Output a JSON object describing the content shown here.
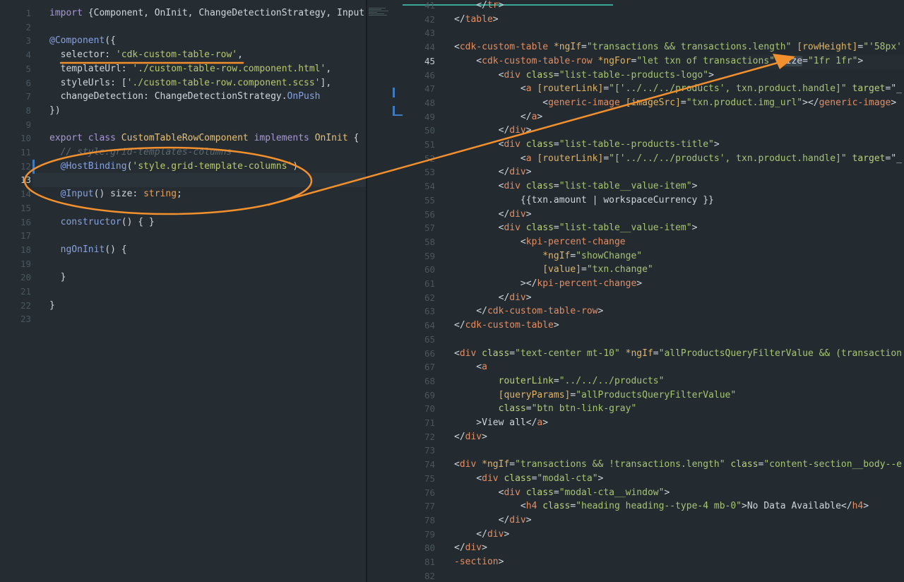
{
  "left_editor": {
    "lines": [
      {
        "n": "1",
        "tokens": [
          [
            "k",
            "import "
          ],
          [
            "p",
            "{Component, OnInit, ChangeDetectionStrategy, Input"
          ]
        ]
      },
      {
        "n": "2",
        "tokens": []
      },
      {
        "n": "3",
        "tokens": [
          [
            "d",
            "@Component"
          ],
          [
            "p",
            "({"
          ]
        ]
      },
      {
        "n": "4",
        "tokens": [
          [
            "p",
            "  selector: "
          ],
          [
            "s",
            "'cdk-custom-table-row'"
          ],
          [
            "p",
            ","
          ]
        ]
      },
      {
        "n": "5",
        "tokens": [
          [
            "p",
            "  templateUrl: "
          ],
          [
            "s",
            "'./custom-table-row.component.html'"
          ],
          [
            "p",
            ","
          ]
        ]
      },
      {
        "n": "6",
        "tokens": [
          [
            "p",
            "  styleUrls: ["
          ],
          [
            "s",
            "'./custom-table-row.component.scss'"
          ],
          [
            "p",
            "],"
          ]
        ]
      },
      {
        "n": "7",
        "tokens": [
          [
            "p",
            "  changeDetection: ChangeDetectionStrategy."
          ],
          [
            "d",
            "OnPush"
          ]
        ]
      },
      {
        "n": "8",
        "tokens": [
          [
            "p",
            "})"
          ]
        ]
      },
      {
        "n": "9",
        "tokens": []
      },
      {
        "n": "10",
        "tokens": [
          [
            "k",
            "export class "
          ],
          [
            "cls",
            "CustomTableRowComponent "
          ],
          [
            "k",
            "implements "
          ],
          [
            "cls",
            "OnInit "
          ],
          [
            "p",
            "{"
          ]
        ]
      },
      {
        "n": "11",
        "tokens": [
          [
            "c",
            "  // style.grid-templates-columns"
          ]
        ]
      },
      {
        "n": "12",
        "tokens": [
          [
            "d",
            "  @HostBinding"
          ],
          [
            "p",
            "("
          ],
          [
            "s",
            "'style.grid-template-columns'"
          ],
          [
            "p",
            ")"
          ]
        ]
      },
      {
        "n": "13",
        "tokens": []
      },
      {
        "n": "14",
        "tokens": [
          [
            "d",
            "  @Input"
          ],
          [
            "p",
            "() size: "
          ],
          [
            "t",
            "string"
          ],
          [
            "p",
            ";"
          ]
        ]
      },
      {
        "n": "15",
        "tokens": []
      },
      {
        "n": "16",
        "tokens": [
          [
            "d",
            "  constructor"
          ],
          [
            "p",
            "() { }"
          ]
        ]
      },
      {
        "n": "17",
        "tokens": []
      },
      {
        "n": "18",
        "tokens": [
          [
            "d",
            "  ngOnInit"
          ],
          [
            "p",
            "() {"
          ]
        ]
      },
      {
        "n": "19",
        "tokens": []
      },
      {
        "n": "20",
        "tokens": [
          [
            "p",
            "  }"
          ]
        ]
      },
      {
        "n": "21",
        "tokens": []
      },
      {
        "n": "22",
        "tokens": [
          [
            "p",
            "}"
          ]
        ]
      },
      {
        "n": "23",
        "tokens": []
      }
    ]
  },
  "right_editor": {
    "lines": [
      {
        "n": "41",
        "tokens": [
          [
            "p",
            "    </"
          ],
          [
            "tag",
            "tr"
          ],
          [
            "p",
            ">"
          ]
        ]
      },
      {
        "n": "42",
        "tokens": [
          [
            "p",
            "</"
          ],
          [
            "tag",
            "table"
          ],
          [
            "p",
            ">"
          ]
        ]
      },
      {
        "n": "43",
        "tokens": []
      },
      {
        "n": "44",
        "tokens": [
          [
            "p",
            "<"
          ],
          [
            "tag",
            "cdk-custom-table "
          ],
          [
            "oth",
            "*ngIf"
          ],
          [
            "p",
            "="
          ],
          [
            "val",
            "\"transactions && transactions.length\" "
          ],
          [
            "oth",
            "[rowHeight]"
          ],
          [
            "p",
            "="
          ],
          [
            "val",
            "\"'58px'"
          ]
        ]
      },
      {
        "n": "45",
        "tokens": [
          [
            "p",
            "    <"
          ],
          [
            "tag",
            "cdk-custom-table-row "
          ],
          [
            "oth",
            "*ngFor"
          ],
          [
            "p",
            "="
          ],
          [
            "val",
            "\"let txn of transactions\" "
          ],
          [
            "hl",
            "size"
          ],
          [
            "p",
            "="
          ],
          [
            "val",
            "\"1fr 1fr\""
          ],
          [
            "p",
            ">"
          ]
        ]
      },
      {
        "n": "46",
        "tokens": [
          [
            "p",
            "        <"
          ],
          [
            "tag",
            "div "
          ],
          [
            "attr",
            "class"
          ],
          [
            "p",
            "="
          ],
          [
            "val",
            "\"list-table--products-logo\""
          ],
          [
            "p",
            ">"
          ]
        ]
      },
      {
        "n": "47",
        "tokens": [
          [
            "p",
            "            <"
          ],
          [
            "tag",
            "a "
          ],
          [
            "oth",
            "[routerLink]"
          ],
          [
            "p",
            "="
          ],
          [
            "val",
            "\"['../../../products', txn.product.handle]\" "
          ],
          [
            "attr",
            "target"
          ],
          [
            "p",
            "=\"_"
          ]
        ]
      },
      {
        "n": "48",
        "tokens": [
          [
            "p",
            "                <"
          ],
          [
            "tag",
            "generic-image "
          ],
          [
            "oth",
            "[imageSrc]"
          ],
          [
            "p",
            "="
          ],
          [
            "val",
            "\"txn.product.img_url\""
          ],
          [
            "p",
            "></"
          ],
          [
            "tag",
            "generic-image"
          ],
          [
            "p",
            ">"
          ]
        ]
      },
      {
        "n": "49",
        "tokens": [
          [
            "p",
            "            </"
          ],
          [
            "tag",
            "a"
          ],
          [
            "p",
            ">"
          ]
        ]
      },
      {
        "n": "50",
        "tokens": [
          [
            "p",
            "        </"
          ],
          [
            "tag",
            "div"
          ],
          [
            "p",
            ">"
          ]
        ]
      },
      {
        "n": "51",
        "tokens": [
          [
            "p",
            "        <"
          ],
          [
            "tag",
            "div "
          ],
          [
            "attr",
            "class"
          ],
          [
            "p",
            "="
          ],
          [
            "val",
            "\"list-table--products-title\""
          ],
          [
            "p",
            ">"
          ]
        ]
      },
      {
        "n": "52",
        "tokens": [
          [
            "p",
            "            <"
          ],
          [
            "tag",
            "a "
          ],
          [
            "oth",
            "[routerLink]"
          ],
          [
            "p",
            "="
          ],
          [
            "val",
            "\"['../../../products', txn.product.handle]\" "
          ],
          [
            "attr",
            "target"
          ],
          [
            "p",
            "=\"_"
          ]
        ]
      },
      {
        "n": "53",
        "tokens": [
          [
            "p",
            "        </"
          ],
          [
            "tag",
            "div"
          ],
          [
            "p",
            ">"
          ]
        ]
      },
      {
        "n": "54",
        "tokens": [
          [
            "p",
            "        <"
          ],
          [
            "tag",
            "div "
          ],
          [
            "attr",
            "class"
          ],
          [
            "p",
            "="
          ],
          [
            "val",
            "\"list-table__value-item\""
          ],
          [
            "p",
            ">"
          ]
        ]
      },
      {
        "n": "55",
        "tokens": [
          [
            "p",
            "            {{txn.amount | workspaceCurrency }}"
          ]
        ]
      },
      {
        "n": "56",
        "tokens": [
          [
            "p",
            "        </"
          ],
          [
            "tag",
            "div"
          ],
          [
            "p",
            ">"
          ]
        ]
      },
      {
        "n": "57",
        "tokens": [
          [
            "p",
            "        <"
          ],
          [
            "tag",
            "div "
          ],
          [
            "attr",
            "class"
          ],
          [
            "p",
            "="
          ],
          [
            "val",
            "\"list-table__value-item\""
          ],
          [
            "p",
            ">"
          ]
        ]
      },
      {
        "n": "58",
        "tokens": [
          [
            "p",
            "            <"
          ],
          [
            "tag",
            "kpi-percent-change"
          ]
        ]
      },
      {
        "n": "59",
        "tokens": [
          [
            "oth",
            "                *ngIf"
          ],
          [
            "p",
            "="
          ],
          [
            "val",
            "\"showChange\""
          ]
        ]
      },
      {
        "n": "60",
        "tokens": [
          [
            "oth",
            "                [value]"
          ],
          [
            "p",
            "="
          ],
          [
            "val",
            "\"txn.change\""
          ]
        ]
      },
      {
        "n": "61",
        "tokens": [
          [
            "p",
            "            ></"
          ],
          [
            "tag",
            "kpi-percent-change"
          ],
          [
            "p",
            ">"
          ]
        ]
      },
      {
        "n": "62",
        "tokens": [
          [
            "p",
            "        </"
          ],
          [
            "tag",
            "div"
          ],
          [
            "p",
            ">"
          ]
        ]
      },
      {
        "n": "63",
        "tokens": [
          [
            "p",
            "    </"
          ],
          [
            "tag",
            "cdk-custom-table-row"
          ],
          [
            "p",
            ">"
          ]
        ]
      },
      {
        "n": "64",
        "tokens": [
          [
            "p",
            "</"
          ],
          [
            "tag",
            "cdk-custom-table"
          ],
          [
            "p",
            ">"
          ]
        ]
      },
      {
        "n": "65",
        "tokens": []
      },
      {
        "n": "66",
        "tokens": [
          [
            "p",
            "<"
          ],
          [
            "tag",
            "div "
          ],
          [
            "attr",
            "class"
          ],
          [
            "p",
            "="
          ],
          [
            "val",
            "\"text-center mt-10\" "
          ],
          [
            "oth",
            "*ngIf"
          ],
          [
            "p",
            "="
          ],
          [
            "val",
            "\"allProductsQueryFilterValue && (transaction"
          ]
        ]
      },
      {
        "n": "67",
        "tokens": [
          [
            "p",
            "    <"
          ],
          [
            "tag",
            "a"
          ]
        ]
      },
      {
        "n": "68",
        "tokens": [
          [
            "attr",
            "        routerLink"
          ],
          [
            "p",
            "="
          ],
          [
            "val",
            "\"../../../products\""
          ]
        ]
      },
      {
        "n": "69",
        "tokens": [
          [
            "oth",
            "        [queryParams]"
          ],
          [
            "p",
            "="
          ],
          [
            "val",
            "\"allProductsQueryFilterValue\""
          ]
        ]
      },
      {
        "n": "70",
        "tokens": [
          [
            "attr",
            "        class"
          ],
          [
            "p",
            "="
          ],
          [
            "val",
            "\"btn btn-link-gray\""
          ]
        ]
      },
      {
        "n": "71",
        "tokens": [
          [
            "p",
            "    >View all</"
          ],
          [
            "tag",
            "a"
          ],
          [
            "p",
            ">"
          ]
        ]
      },
      {
        "n": "72",
        "tokens": [
          [
            "p",
            "</"
          ],
          [
            "tag",
            "div"
          ],
          [
            "p",
            ">"
          ]
        ]
      },
      {
        "n": "73",
        "tokens": []
      },
      {
        "n": "74",
        "tokens": [
          [
            "p",
            "<"
          ],
          [
            "tag",
            "div "
          ],
          [
            "oth",
            "*ngIf"
          ],
          [
            "p",
            "="
          ],
          [
            "val",
            "\"transactions && !transactions.length\" "
          ],
          [
            "attr",
            "class"
          ],
          [
            "p",
            "="
          ],
          [
            "val",
            "\"content-section__body--e"
          ]
        ]
      },
      {
        "n": "75",
        "tokens": [
          [
            "p",
            "    <"
          ],
          [
            "tag",
            "div "
          ],
          [
            "attr",
            "class"
          ],
          [
            "p",
            "="
          ],
          [
            "val",
            "\"modal-cta\""
          ],
          [
            "p",
            ">"
          ]
        ]
      },
      {
        "n": "76",
        "tokens": [
          [
            "p",
            "        <"
          ],
          [
            "tag",
            "div "
          ],
          [
            "attr",
            "class"
          ],
          [
            "p",
            "="
          ],
          [
            "val",
            "\"modal-cta__window\""
          ],
          [
            "p",
            ">"
          ]
        ]
      },
      {
        "n": "77",
        "tokens": [
          [
            "p",
            "            <"
          ],
          [
            "tag",
            "h4 "
          ],
          [
            "attr",
            "class"
          ],
          [
            "p",
            "="
          ],
          [
            "val",
            "\"heading heading--type-4 mb-0\""
          ],
          [
            "p",
            ">No Data Available</"
          ],
          [
            "tag",
            "h4"
          ],
          [
            "p",
            ">"
          ]
        ]
      },
      {
        "n": "78",
        "tokens": [
          [
            "p",
            "        </"
          ],
          [
            "tag",
            "div"
          ],
          [
            "p",
            ">"
          ]
        ]
      },
      {
        "n": "79",
        "tokens": [
          [
            "p",
            "    </"
          ],
          [
            "tag",
            "div"
          ],
          [
            "p",
            ">"
          ]
        ]
      },
      {
        "n": "80",
        "tokens": [
          [
            "p",
            "</"
          ],
          [
            "tag",
            "div"
          ],
          [
            "p",
            ">"
          ]
        ]
      },
      {
        "n": "81",
        "tokens": [
          [
            "tag",
            "-section"
          ],
          [
            "p",
            ">"
          ]
        ]
      },
      {
        "n": "82",
        "tokens": []
      }
    ]
  },
  "colors": {
    "annotation": "#f2902e",
    "accent": "#3aa796",
    "git_modified": "#3f7bbf"
  }
}
